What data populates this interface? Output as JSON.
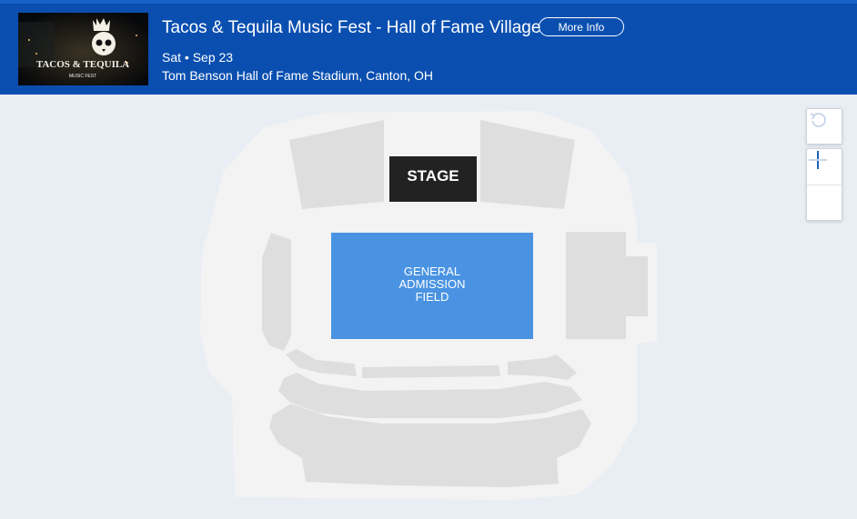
{
  "event": {
    "title": "Tacos & Tequila Music Fest - Hall of Fame Village",
    "more_info_label": "More Info",
    "date": "Sat • Sep 23",
    "venue": "Tom Benson Hall of Fame Stadium, Canton, OH",
    "thumbnail_text": "TACOS & TEQUILA",
    "thumbnail_subtext": "MUSIC FEST"
  },
  "map": {
    "stage_label": "STAGE",
    "ga_label_line1": "GENERAL",
    "ga_label_line2": "ADMISSION",
    "ga_label_line3": "FIELD"
  },
  "controls": {
    "reset_icon": "reset-icon",
    "zoom_in_icon": "plus-icon",
    "zoom_out_icon": "minus-icon"
  },
  "colors": {
    "header_bg": "#0a4fb0",
    "ga_field": "#4a93e2",
    "stage": "#222222",
    "section_gray": "#dedede",
    "map_bg": "#e9edf4",
    "control_blue": "#1f64b8"
  }
}
